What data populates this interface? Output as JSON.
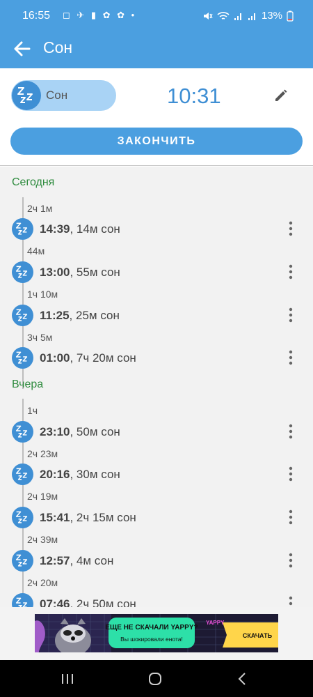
{
  "status_bar": {
    "time": "16:55",
    "notification_icons": "◻ ✈ ▮ ✿ ✿ •",
    "battery_percent": "13%"
  },
  "app_bar": {
    "title": "Сон"
  },
  "current": {
    "mode_label": "Сон",
    "timer": "10:31",
    "finish_label": "ЗАКОНЧИТЬ"
  },
  "days": [
    {
      "label": "Сегодня",
      "entries": [
        {
          "gap": "2ч 1м",
          "time": "14:39",
          "details": ", 14м сон"
        },
        {
          "gap": "44м",
          "time": "13:00",
          "details": ", 55м сон"
        },
        {
          "gap": "1ч 10м",
          "time": "11:25",
          "details": ", 25м сон"
        },
        {
          "gap": "3ч 5м",
          "time": "01:00",
          "details": ", 7ч 20м сон"
        }
      ]
    },
    {
      "label": "Вчера",
      "entries": [
        {
          "gap": "1ч",
          "time": "23:10",
          "details": ", 50м сон"
        },
        {
          "gap": "2ч 23м",
          "time": "20:16",
          "details": ", 30м сон"
        },
        {
          "gap": "2ч 19м",
          "time": "15:41",
          "details": ", 2ч 15м сон"
        },
        {
          "gap": "2ч 39м",
          "time": "12:57",
          "details": ", 4м сон"
        },
        {
          "gap": "2ч 20м",
          "time": "07:46",
          "details": ", 2ч 50м сон"
        }
      ]
    }
  ],
  "ad": {
    "headline": "ЕЩЕ НЕ СКАЧАЛИ YAPPY?",
    "subline": "Вы шокировали енота!",
    "brand": "YAPPY",
    "cta": "СКАЧАТЬ"
  },
  "colors": {
    "primary": "#4b9fe0",
    "section_green": "#2e8b3e",
    "list_bg": "#f2f2f2",
    "pill_bg": "#a9d3f5"
  }
}
